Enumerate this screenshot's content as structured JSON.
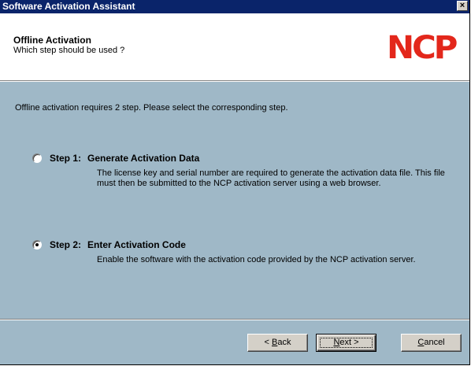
{
  "window": {
    "title": "Software Activation Assistant",
    "close_glyph": "×"
  },
  "header": {
    "title": "Offline Activation",
    "subtitle": "Which step should be used ?",
    "logo_text": "NCP",
    "logo_color": "#e3271b"
  },
  "content": {
    "intro": "Offline activation requires 2 step. Please select the corresponding step.",
    "options": [
      {
        "num": "Step 1:",
        "label": "Generate Activation Data",
        "description": "The license key and serial number are required to generate the activation data file. This file must then be submitted to the NCP activation server using a web browser.",
        "selected": false
      },
      {
        "num": "Step 2:",
        "label": "Enter Activation Code",
        "description": "Enable the software with the activation code provided by the NCP activation server.",
        "selected": true
      }
    ]
  },
  "buttons": {
    "back_prefix": "< ",
    "back_key": "B",
    "back_rest": "ack",
    "next_key": "N",
    "next_rest": "ext >",
    "cancel_key": "C",
    "cancel_rest": "ancel"
  },
  "colors": {
    "titlebar": "#0a246a",
    "dialog_body": "#9fb8c7",
    "button_face": "#d4d0c8"
  }
}
